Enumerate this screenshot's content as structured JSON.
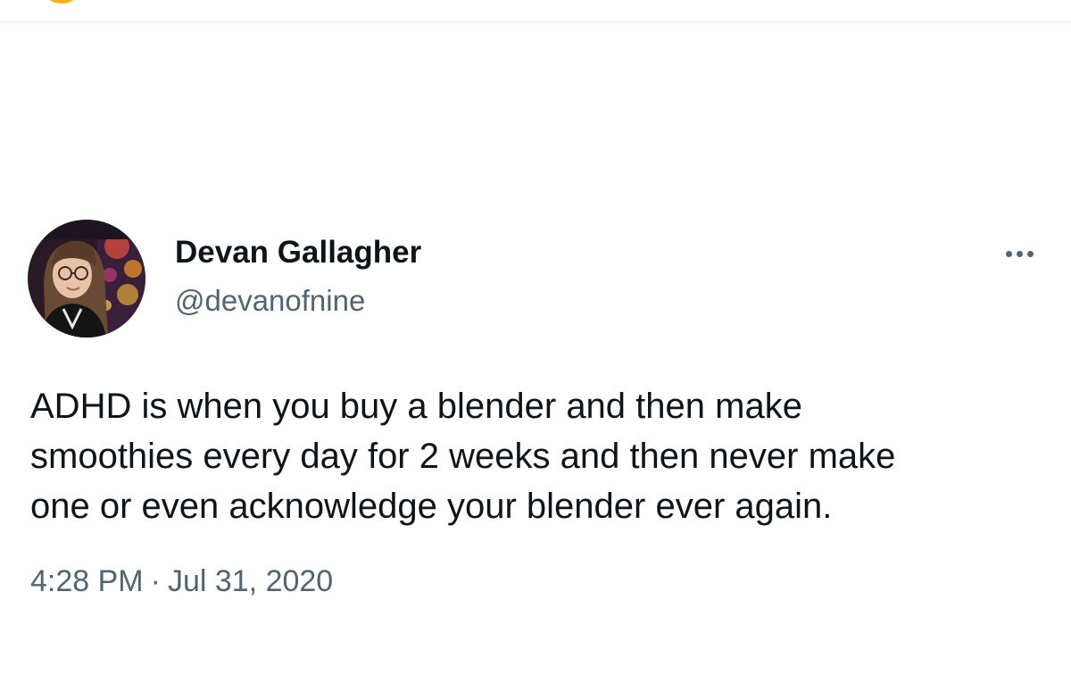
{
  "tweet": {
    "author": {
      "display_name": "Devan Gallagher",
      "handle": "@devanofnine",
      "avatar_icon": "profile-photo"
    },
    "more_icon": "more-options-icon",
    "text": "ADHD is when you buy a blender and then make\nsmoothies every day for 2 weeks and then never make\none or even acknowledge your blender ever again.",
    "time": "4:28 PM",
    "separator": "·",
    "date": "Jul 31, 2020"
  },
  "colors": {
    "text_primary": "#0f1419",
    "text_secondary": "#536471",
    "background": "#ffffff",
    "top_accent": "#f2b31d"
  }
}
